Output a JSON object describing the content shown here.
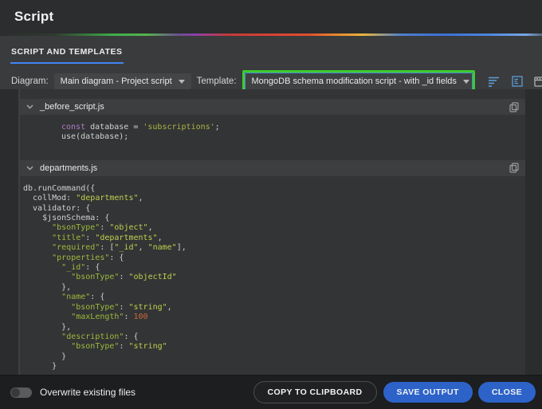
{
  "window": {
    "title": "Script"
  },
  "tabs": [
    {
      "label": "SCRIPT AND TEMPLATES",
      "active": true
    }
  ],
  "toolbar": {
    "diagram_label": "Diagram:",
    "diagram_value": "Main diagram - Project script",
    "template_label": "Template:",
    "template_value": "MongoDB schema modification script - with _id fields",
    "icons": [
      "wrap-lines-icon",
      "script-panel-icon",
      "window-icon",
      "folder-open-icon",
      "undo-icon",
      "info-icon"
    ]
  },
  "sections": [
    {
      "filename": "_before_script.js",
      "collapsed": false,
      "indented": true,
      "lines": [
        [
          [
            "k",
            "const"
          ],
          [
            "p",
            " database = "
          ],
          [
            "s2",
            "'subscriptions'"
          ],
          [
            "p",
            ";"
          ]
        ],
        [
          [
            "p",
            "use(database);"
          ]
        ]
      ]
    },
    {
      "filename": "departments.js",
      "collapsed": false,
      "indented": false,
      "lines": [
        [
          [
            "p",
            "db.runCommand({"
          ]
        ],
        [
          [
            "p",
            "  collMod: "
          ],
          [
            "s",
            "\"departments\""
          ],
          [
            "p",
            ","
          ]
        ],
        [
          [
            "p",
            "  validator: {"
          ]
        ],
        [
          [
            "p",
            "    $jsonSchema: {"
          ]
        ],
        [
          [
            "p",
            "      "
          ],
          [
            "key",
            "\"bsonType\""
          ],
          [
            "p",
            ": "
          ],
          [
            "s",
            "\"object\""
          ],
          [
            "p",
            ","
          ]
        ],
        [
          [
            "p",
            "      "
          ],
          [
            "key",
            "\"title\""
          ],
          [
            "p",
            ": "
          ],
          [
            "s",
            "\"departments\""
          ],
          [
            "p",
            ","
          ]
        ],
        [
          [
            "p",
            "      "
          ],
          [
            "key",
            "\"required\""
          ],
          [
            "p",
            ": ["
          ],
          [
            "s",
            "\"_id\""
          ],
          [
            "p",
            ", "
          ],
          [
            "s",
            "\"name\""
          ],
          [
            "p",
            "],"
          ]
        ],
        [
          [
            "p",
            "      "
          ],
          [
            "key",
            "\"properties\""
          ],
          [
            "p",
            ": {"
          ]
        ],
        [
          [
            "p",
            "        "
          ],
          [
            "key",
            "\"_id\""
          ],
          [
            "p",
            ": {"
          ]
        ],
        [
          [
            "p",
            "          "
          ],
          [
            "key",
            "\"bsonType\""
          ],
          [
            "p",
            ": "
          ],
          [
            "s",
            "\"objectId\""
          ]
        ],
        [
          [
            "p",
            "        },"
          ]
        ],
        [
          [
            "p",
            "        "
          ],
          [
            "key",
            "\"name\""
          ],
          [
            "p",
            ": {"
          ]
        ],
        [
          [
            "p",
            "          "
          ],
          [
            "key",
            "\"bsonType\""
          ],
          [
            "p",
            ": "
          ],
          [
            "s",
            "\"string\""
          ],
          [
            "p",
            ","
          ]
        ],
        [
          [
            "p",
            "          "
          ],
          [
            "key",
            "\"maxLength\""
          ],
          [
            "p",
            ": "
          ],
          [
            "n",
            "100"
          ]
        ],
        [
          [
            "p",
            "        },"
          ]
        ],
        [
          [
            "p",
            "        "
          ],
          [
            "key",
            "\"description\""
          ],
          [
            "p",
            ": {"
          ]
        ],
        [
          [
            "p",
            "          "
          ],
          [
            "key",
            "\"bsonType\""
          ],
          [
            "p",
            ": "
          ],
          [
            "s",
            "\"string\""
          ]
        ],
        [
          [
            "p",
            "        }"
          ]
        ],
        [
          [
            "p",
            "      }"
          ]
        ]
      ]
    }
  ],
  "footer": {
    "toggle_label": "Overwrite existing files",
    "toggle_on": false,
    "copy_button": "COPY TO CLIPBOARD",
    "save_button": "SAVE OUTPUT",
    "close_button": "CLOSE"
  },
  "colors": {
    "accent_blue": "#4285f4",
    "button_blue": "#2d63c8",
    "highlight_green": "#3ecb2f",
    "code_keyword": "#b07cc6",
    "code_key": "#9db93c",
    "code_string": "#c0cf4e",
    "code_number": "#cd6839"
  }
}
